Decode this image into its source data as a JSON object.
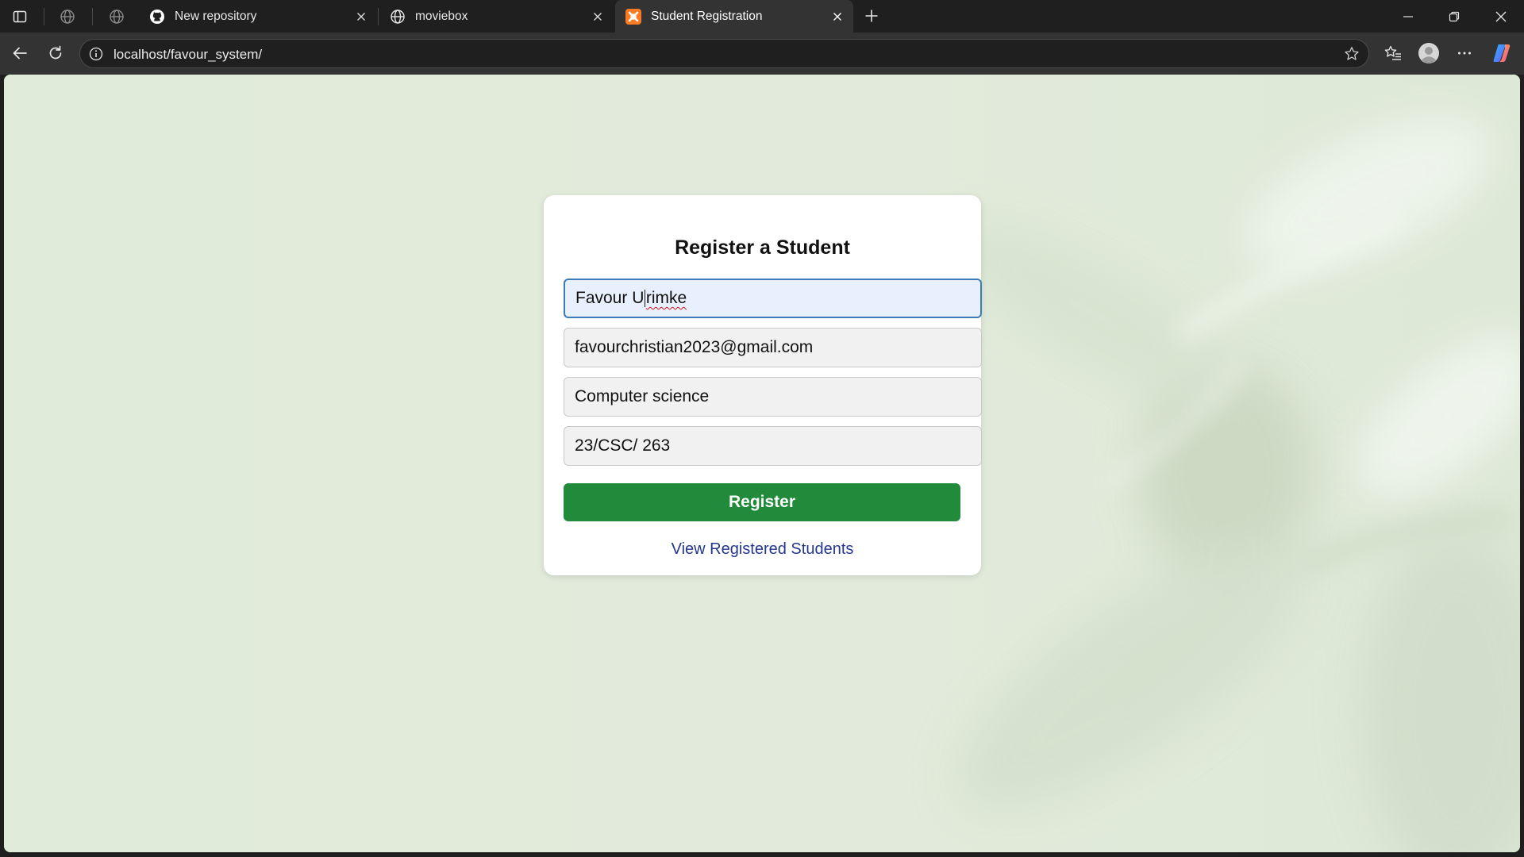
{
  "browser": {
    "tabs": [
      {
        "title": "New repository",
        "favicon": "github-icon"
      },
      {
        "title": "moviebox",
        "favicon": "globe-icon"
      },
      {
        "title": "Student Registration",
        "favicon": "xampp-icon",
        "active": true
      }
    ],
    "address_bar": {
      "url": "localhost/favour_system/"
    }
  },
  "form": {
    "heading": "Register a Student",
    "fields": {
      "name": {
        "value_before_caret": "Favour U",
        "value_after_caret": "rimke",
        "misspelled": "Urimke"
      },
      "email": {
        "value": "favourchristian2023@gmail.com"
      },
      "department": {
        "value": "Computer science"
      },
      "matric_number": {
        "value": "23/CSC/ 263"
      }
    },
    "register_button_label": "Register",
    "view_link_label": "View Registered Students"
  },
  "colors": {
    "page_background": "#e2ebdb",
    "register_button": "#228b3b",
    "link": "#24378f",
    "focused_border": "#3d7bb8"
  }
}
